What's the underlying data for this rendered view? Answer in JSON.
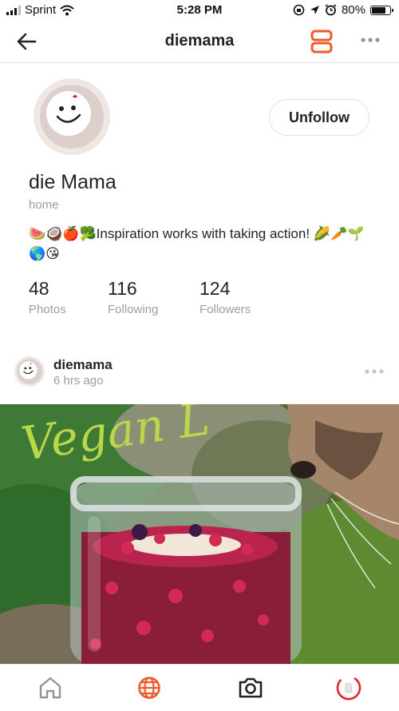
{
  "status_bar": {
    "carrier": "Sprint",
    "time": "5:28 PM",
    "battery": "80%",
    "battery_level": 0.8
  },
  "nav": {
    "title": "diemama"
  },
  "profile": {
    "button_label": "Unfollow",
    "display_name": "die Mama",
    "location": "home",
    "bio": "🍉🥥🍎🥦Inspiration works with taking action! 🌽🥕🌱🌎😘",
    "stats": [
      {
        "value": "48",
        "label": "Photos"
      },
      {
        "value": "116",
        "label": "Following"
      },
      {
        "value": "124",
        "label": "Followers"
      }
    ]
  },
  "post": {
    "username": "diemama",
    "time": "6 hrs ago",
    "image_overlay_text": "Vegan L"
  },
  "colors": {
    "accent": "#f05a28",
    "text": "#1d2327",
    "muted": "#9aa0a4"
  },
  "tabs": [
    {
      "icon": "home-icon"
    },
    {
      "icon": "globe-icon",
      "active": true
    },
    {
      "icon": "camera-icon"
    },
    {
      "icon": "progress-ring-icon"
    }
  ]
}
